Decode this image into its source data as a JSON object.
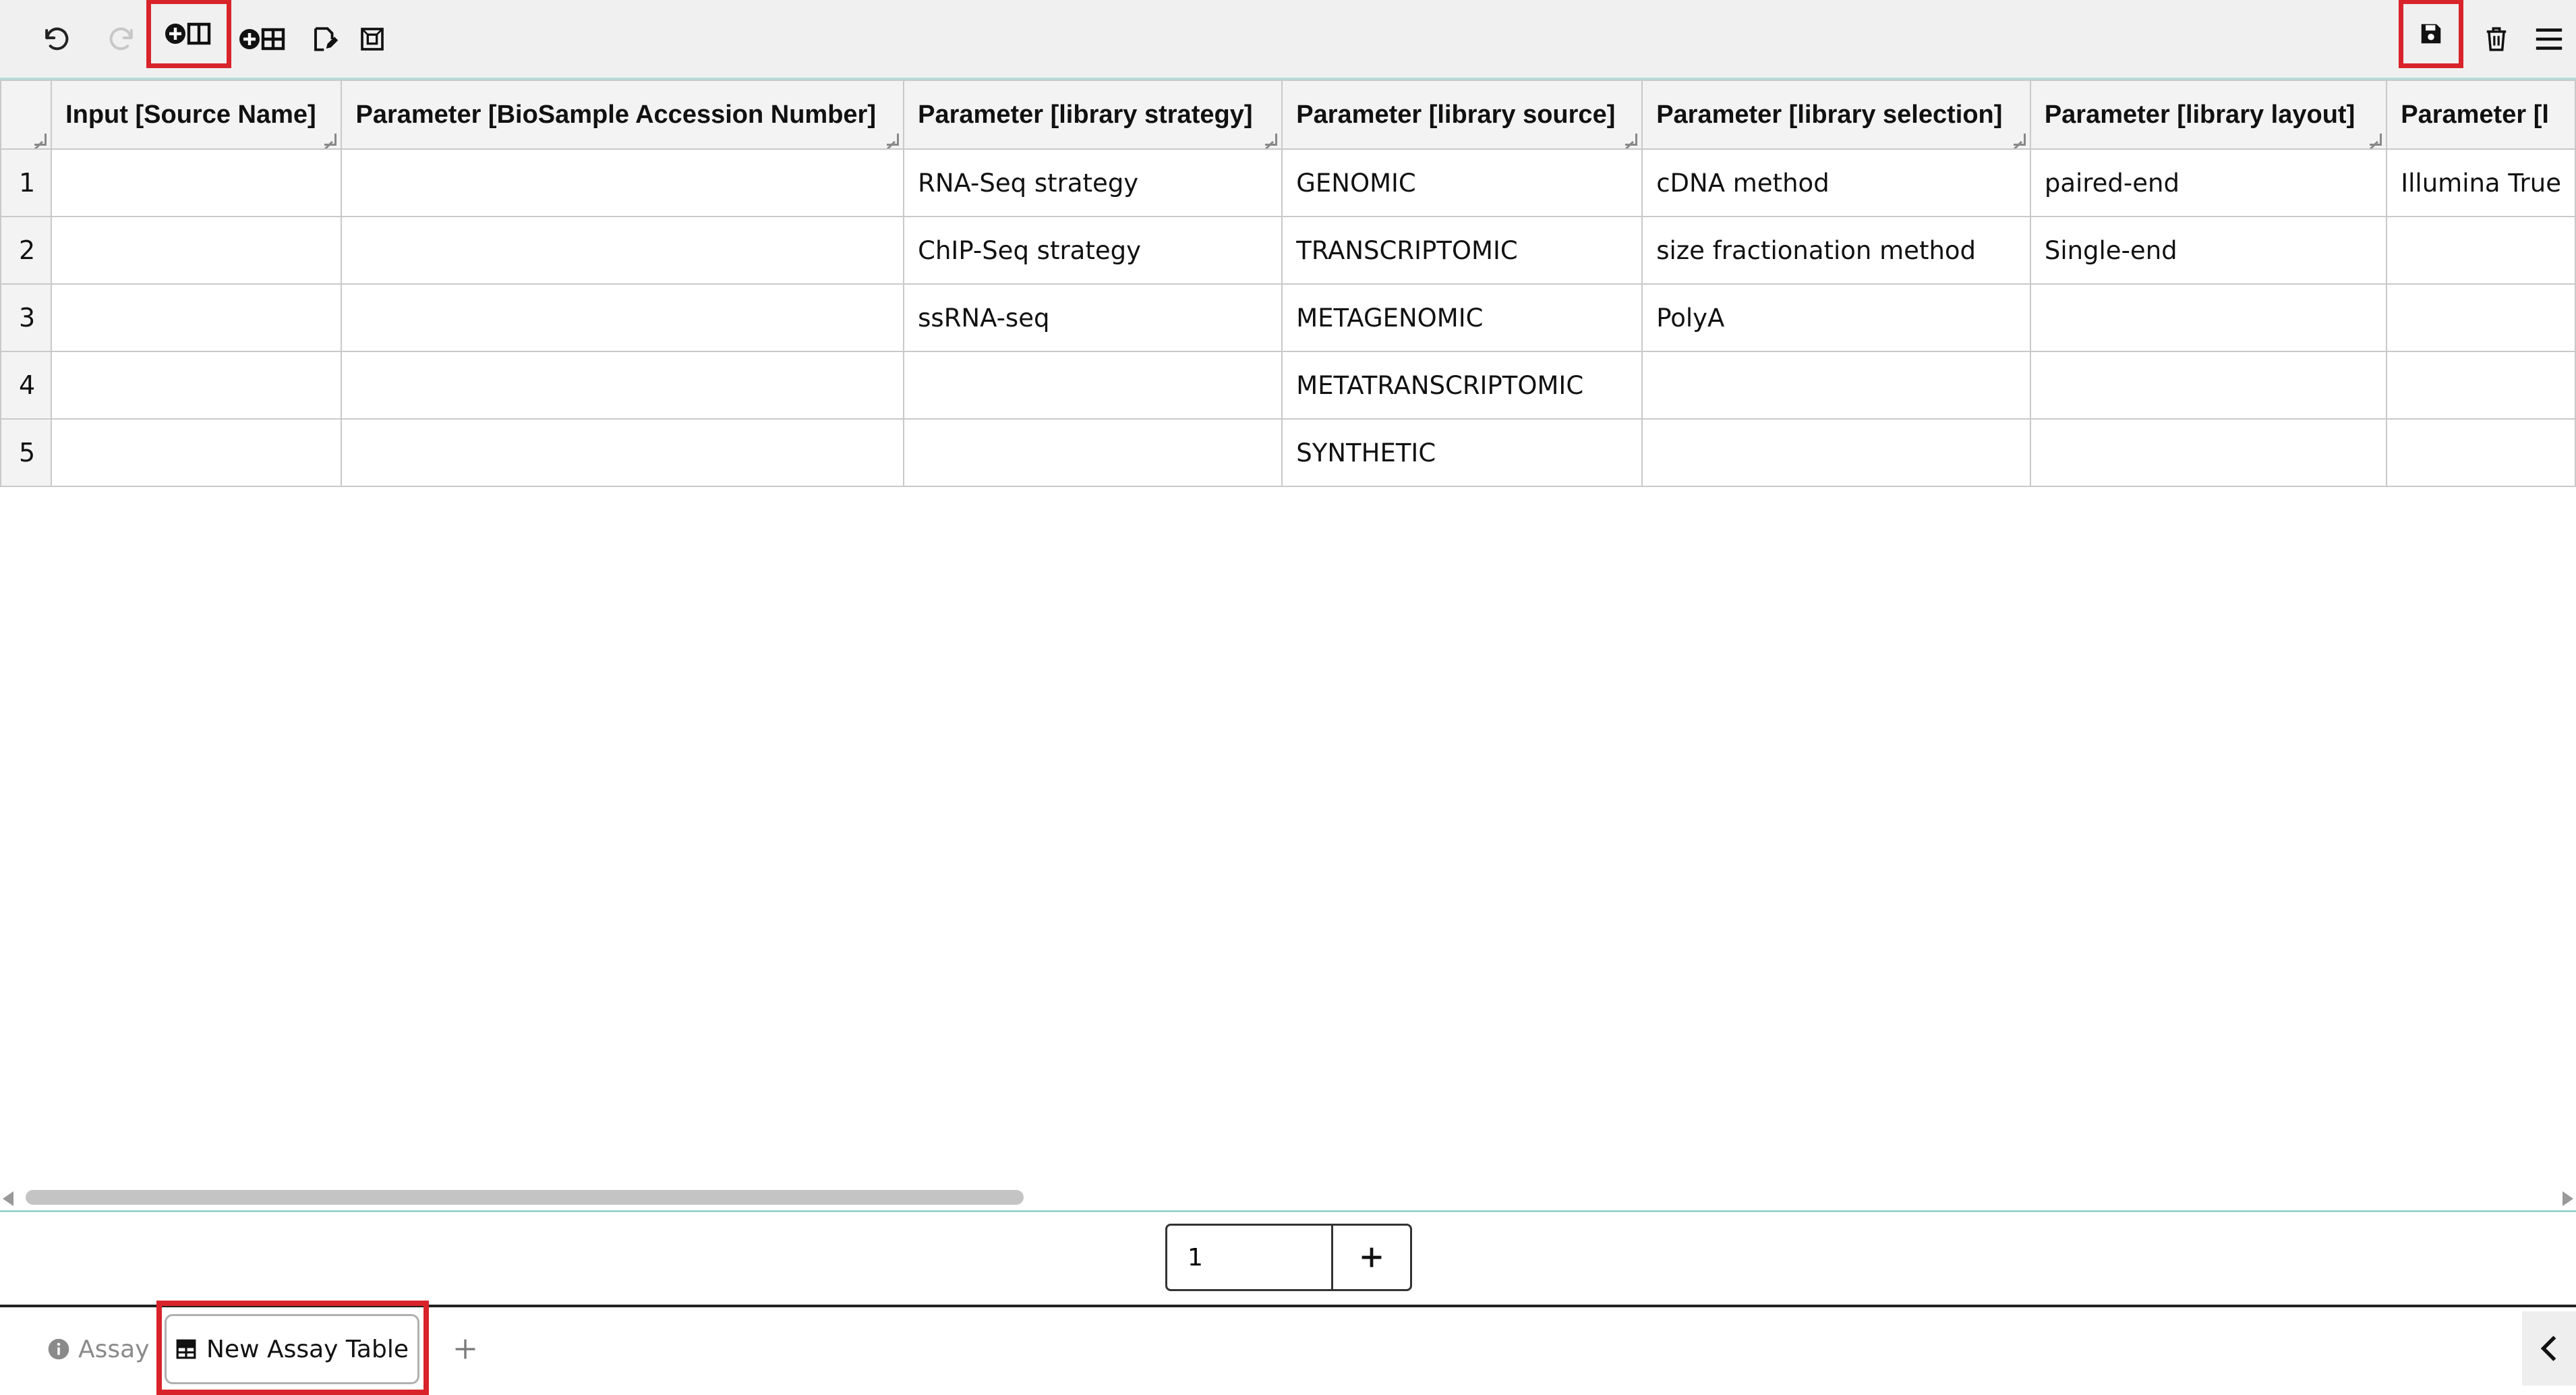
{
  "toolbar": {
    "undo_icon": "undo-icon",
    "redo_icon": "redo-icon",
    "add_column_icon": "add-column-icon",
    "add_table_icon": "add-table-icon",
    "edit_icon": "edit-icon",
    "select_icon": "select-all-icon",
    "save_icon": "save-icon",
    "delete_icon": "trash-icon",
    "menu_icon": "menu-icon"
  },
  "table": {
    "headers": [
      "Input [Source Name]",
      "Parameter [BioSample Accession Number]",
      "Parameter [library strategy]",
      "Parameter [library source]",
      "Parameter [library selection]",
      "Parameter [library layout]",
      "Parameter [l"
    ],
    "rows": [
      {
        "num": "1",
        "cells": [
          "",
          "",
          "RNA-Seq strategy",
          "GENOMIC",
          "cDNA method",
          "paired-end",
          "Illumina True"
        ]
      },
      {
        "num": "2",
        "cells": [
          "",
          "",
          "ChIP-Seq strategy",
          "TRANSCRIPTOMIC",
          "size fractionation method",
          "Single-end",
          ""
        ]
      },
      {
        "num": "3",
        "cells": [
          "",
          "",
          "ssRNA-seq",
          "METAGENOMIC",
          "PolyA",
          "",
          ""
        ]
      },
      {
        "num": "4",
        "cells": [
          "",
          "",
          "",
          "METATRANSCRIPTOMIC",
          "",
          "",
          ""
        ]
      },
      {
        "num": "5",
        "cells": [
          "",
          "",
          "",
          "SYNTHETIC",
          "",
          "",
          ""
        ]
      }
    ]
  },
  "pager": {
    "row_count_value": "1",
    "add_label": "+"
  },
  "tabs": {
    "assay_label": "Assay",
    "new_table_label": "New Assay Table",
    "add_tab_label": "+"
  },
  "colors": {
    "highlight": "#d9232a",
    "accent_teal": "#9cd4cf"
  }
}
